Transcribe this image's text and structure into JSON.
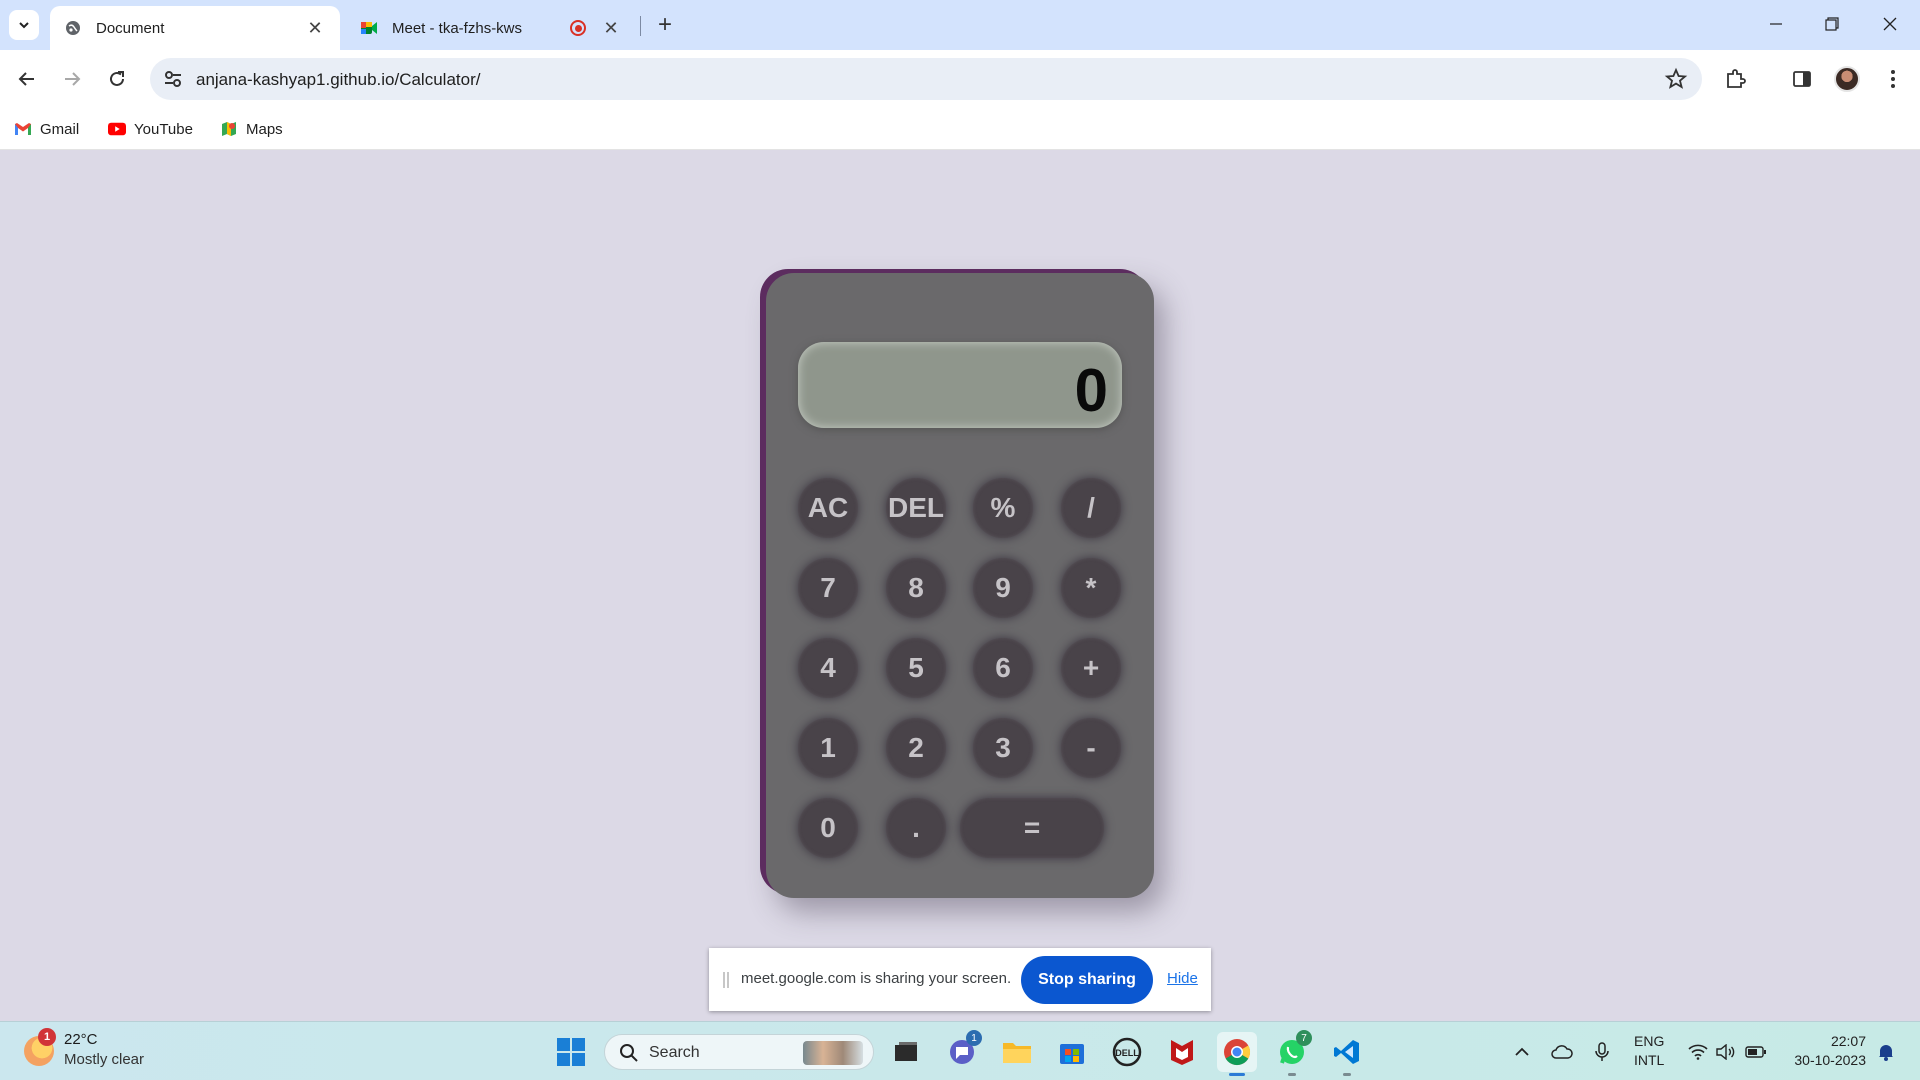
{
  "browser": {
    "tabs": [
      {
        "title": "Document",
        "favicon": "globe-icon",
        "active": true
      },
      {
        "title": "Meet - tka-fzhs-kws",
        "favicon": "google-meet-icon",
        "recording": true,
        "active": false
      }
    ],
    "url": "anjana-kashyap1.github.io/Calculator/",
    "bookmarks": [
      {
        "label": "Gmail",
        "icon": "gmail-icon"
      },
      {
        "label": "YouTube",
        "icon": "youtube-icon"
      },
      {
        "label": "Maps",
        "icon": "maps-icon"
      }
    ]
  },
  "calculator": {
    "display": "0",
    "keys": [
      [
        "AC",
        "DEL",
        "%",
        "/"
      ],
      [
        "7",
        "8",
        "9",
        "*"
      ],
      [
        "4",
        "5",
        "6",
        "+"
      ],
      [
        "1",
        "2",
        "3",
        "-"
      ],
      [
        "0",
        ".",
        "="
      ]
    ],
    "colors": {
      "body": "#6a696b",
      "display": "#8f968c",
      "key": "#494349",
      "key_text": "#c6c3c7",
      "accent_shadow": "#5c2c5f"
    }
  },
  "share_banner": {
    "message": "meet.google.com is sharing your screen.",
    "stop_label": "Stop sharing",
    "hide_label": "Hide"
  },
  "taskbar": {
    "weather": {
      "temp": "22°C",
      "desc": "Mostly clear",
      "badge": "1"
    },
    "search_label": "Search",
    "teams_badge": "1",
    "whatsapp_badge": "7",
    "language": {
      "line1": "ENG",
      "line2": "INTL"
    },
    "clock": {
      "time": "22:07",
      "date": "30-10-2023"
    }
  }
}
